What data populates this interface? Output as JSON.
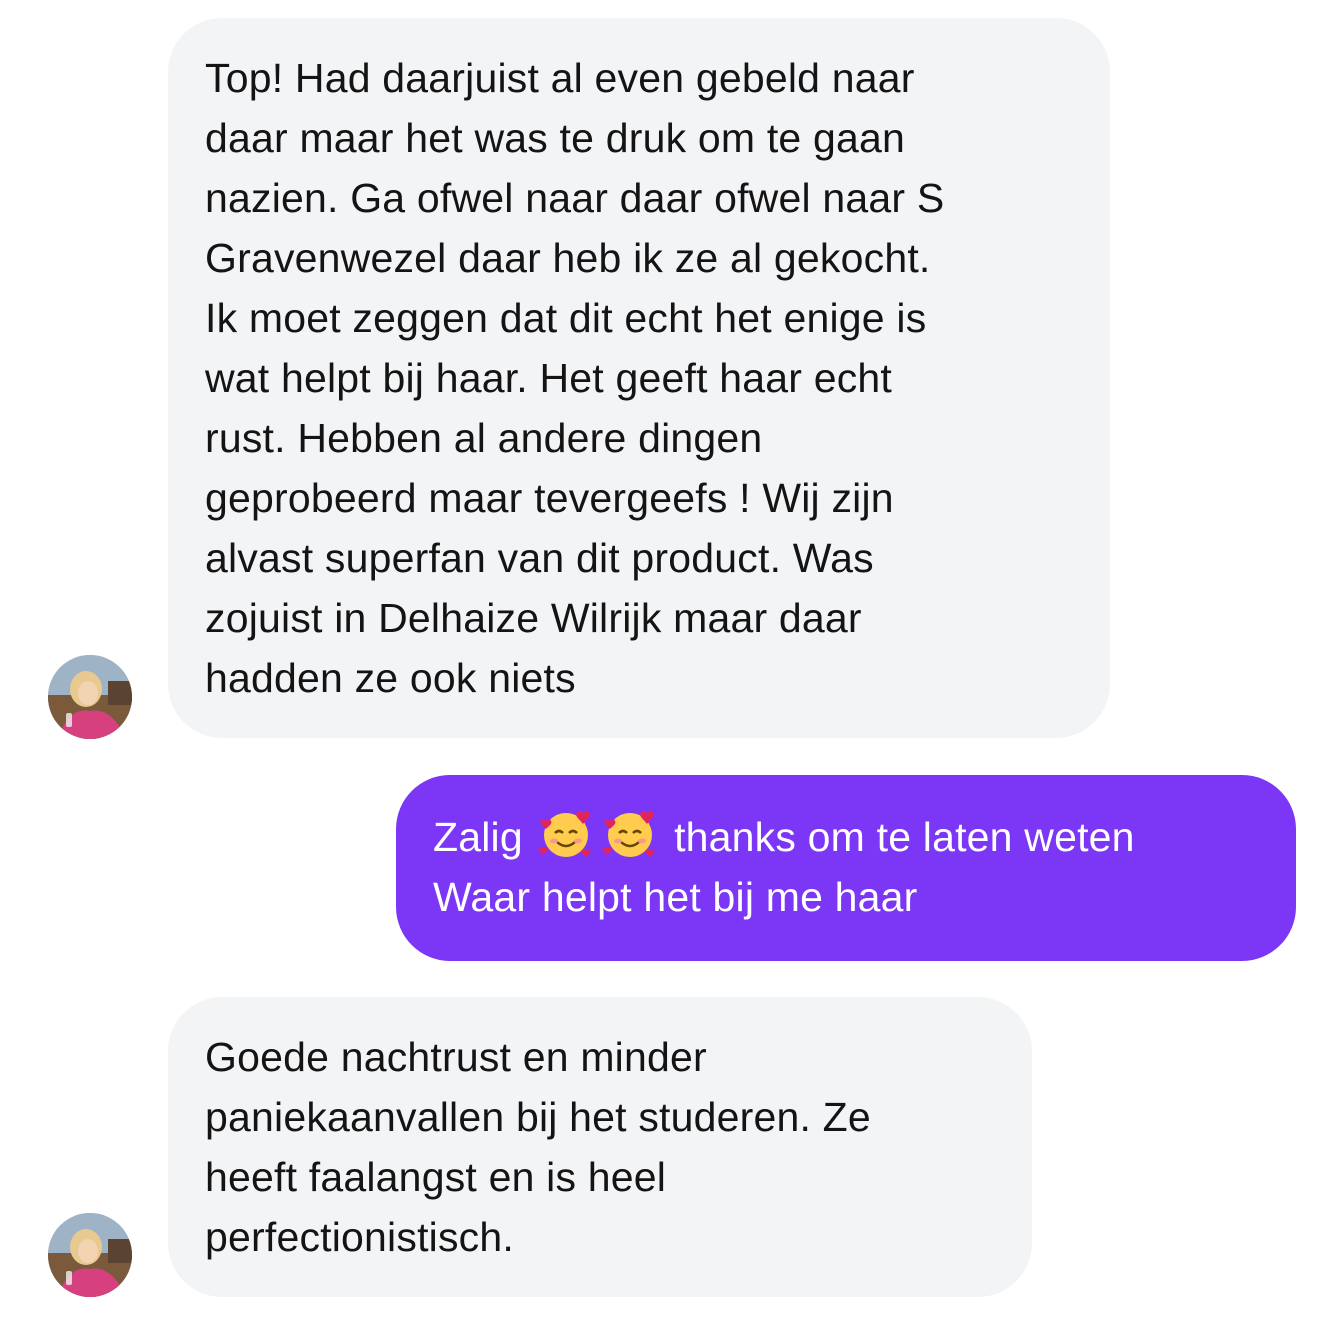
{
  "colors": {
    "incoming_bubble": "#f3f4f6",
    "outgoing_bubble": "#7c37f6",
    "incoming_text": "#141414",
    "outgoing_text": "#ffffff"
  },
  "conversation": {
    "messages": [
      {
        "direction": "incoming",
        "text": "Top! Had daarjuist al even gebeld naar\ndaar maar het was te druk om te gaan\nnazien. Ga ofwel naar daar ofwel naar S\nGravenwezel daar heb ik ze al gekocht.\nIk moet zeggen dat dit echt het enige is\nwat helpt bij haar. Het geeft haar echt\nrust. Hebben al andere dingen\ngeprobeerd maar tevergeefs ! Wij zijn\nalvast superfan van dit product. Was\nzojuist in Delhaize Wilrijk maar daar\nhadden ze ook niets",
        "avatar_icon": "contact-avatar"
      },
      {
        "direction": "outgoing",
        "text_before_emoji": "Zalig",
        "emoji_icon": "smiling-face-with-hearts-emoji",
        "emoji_count": 2,
        "text_after_emoji": "thanks om te laten weten",
        "line2": "Waar helpt het bij me haar"
      },
      {
        "direction": "incoming",
        "text": "Goede nachtrust en minder\npaniekaanvallen bij het studeren. Ze\nheeft faalangst en is heel\nperfectionistisch.",
        "avatar_icon": "contact-avatar"
      }
    ]
  }
}
